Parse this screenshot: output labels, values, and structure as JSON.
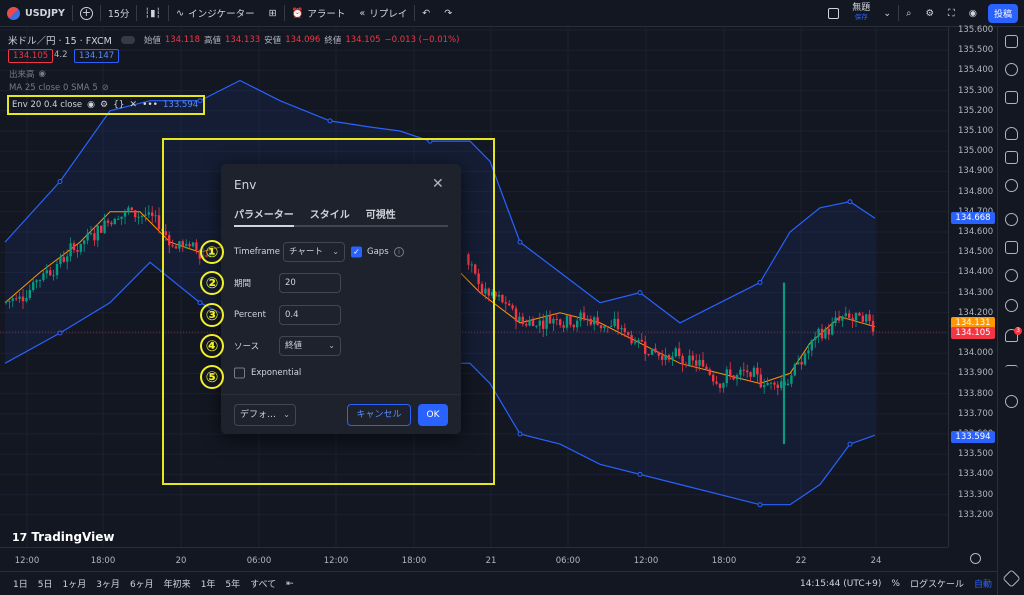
{
  "toolbar": {
    "symbol": "USDJPY",
    "interval": "15分",
    "indicators": "インジケーター",
    "alert": "アラート",
    "replay": "リプレイ",
    "save_label": "無題",
    "save_sub": "保存",
    "post": "投稿"
  },
  "legend": {
    "title": "米ドル／円 · 15 · FXCM",
    "open_label": "始値",
    "open": "134.118",
    "high_label": "高値",
    "high": "134.133",
    "low_label": "安値",
    "low": "134.096",
    "close_label": "終値",
    "close": "134.105",
    "change": "−0.013 (−0.01%)",
    "bid": "134.105",
    "spread": "4.2",
    "ask": "134.147"
  },
  "indicators": {
    "volume": "出来高",
    "ma": "MA 25 close 0 SMA 5",
    "env": "Env 20 0.4 close",
    "env_value": "133.594"
  },
  "dialog": {
    "title": "Env",
    "tabs": [
      "パラメーター",
      "スタイル",
      "可視性"
    ],
    "timeframe_label": "Timeframe",
    "timeframe_value": "チャート",
    "gaps_label": "Gaps",
    "period_label": "期間",
    "period_value": "20",
    "percent_label": "Percent",
    "percent_value": "0.4",
    "source_label": "ソース",
    "source_value": "終値",
    "exponential_label": "Exponential",
    "defaults": "デフォ…",
    "cancel": "キャンセル",
    "ok": "OK"
  },
  "markers": [
    "①",
    "②",
    "③",
    "④",
    "⑤"
  ],
  "price_axis": {
    "ticks": [
      "135.600",
      "135.500",
      "135.400",
      "135.300",
      "135.200",
      "135.100",
      "135.000",
      "134.900",
      "134.800",
      "134.700",
      "134.600",
      "134.500",
      "134.400",
      "134.300",
      "134.200",
      "134.100",
      "134.000",
      "133.900",
      "133.800",
      "133.700",
      "133.600",
      "133.500",
      "133.400",
      "133.300",
      "133.200"
    ],
    "label_upper": "134.668",
    "label_ma": "134.131",
    "label_close": "134.105",
    "label_lower": "133.594"
  },
  "time_axis": {
    "ticks": [
      "12:00",
      "18:00",
      "20",
      "06:00",
      "12:00",
      "18:00",
      "21",
      "06:00",
      "12:00",
      "18:00",
      "22",
      "24"
    ]
  },
  "bottom": {
    "ranges": [
      "1日",
      "5日",
      "1ヶ月",
      "3ヶ月",
      "6ヶ月",
      "年初来",
      "1年",
      "5年",
      "すべて"
    ],
    "clock": "14:15:44 (UTC+9)",
    "percent": "%",
    "log": "ログスケール",
    "auto": "自動"
  },
  "brand": "TradingView",
  "colors": {
    "band": "#2962ff",
    "ma": "#ff9800",
    "up": "#089981",
    "down": "#f23645",
    "highlight": "#e5e820"
  }
}
